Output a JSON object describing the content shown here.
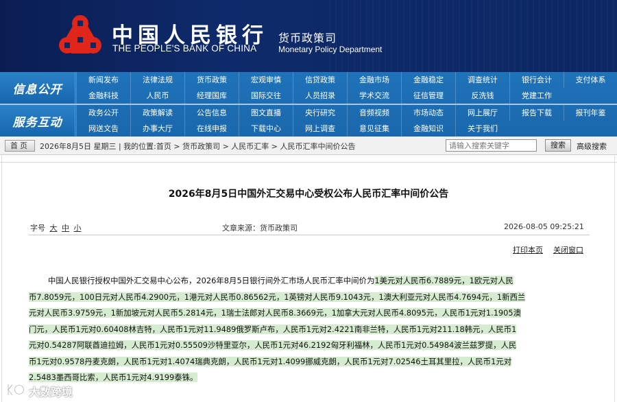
{
  "header": {
    "bank_name_cn": "中国人民银行",
    "bank_name_en": "THE PEOPLE'S BANK OF CHINA",
    "dept_cn": "货币政策司",
    "dept_en": "Monetary Policy Department",
    "emblem_color": "#e0251b",
    "bg_color": "#0c2763"
  },
  "nav": {
    "cat1": "信息公开",
    "cat2": "服务互动",
    "row1": [
      "新闻发布",
      "法律法规",
      "货币政策",
      "宏观审慎",
      "信贷政策",
      "金融市场",
      "金融稳定",
      "调查统计",
      "银行会计",
      "支付体系"
    ],
    "row2": [
      "金融科技",
      "人民币",
      "经理国库",
      "国际交往",
      "人员招录",
      "学术交流",
      "征信管理",
      "反洗钱",
      "党建工作",
      ""
    ],
    "row3": [
      "政务公开",
      "政策解读",
      "公告信息",
      "图文直播",
      "央行研究",
      "音频视频",
      "市场动态",
      "网上展厅",
      "报告下载",
      "报刊年鉴"
    ],
    "row4": [
      "网送文告",
      "办事大厅",
      "在线申报",
      "下载中心",
      "网上调查",
      "意见征集",
      "金融知识",
      "关于我们",
      "",
      ""
    ]
  },
  "breadcrumb": {
    "home": "首页",
    "text": "2026年8月5日 星期三 | 我的位置:首页 > 货币政策司 > 人民币汇率 > 人民币汇率中间价公告",
    "search_placeholder": "请输入搜索关键字",
    "search_button": "搜索",
    "advanced": "高级搜索"
  },
  "article": {
    "title": "2026年8月5日中国外汇交易中心受权公布人民币汇率中间价公告",
    "font_label": "字号",
    "font_large": "大",
    "font_medium": "中",
    "font_small": "小",
    "source": "文章来源：货币政策司",
    "date": "2026-08-05 09:25:21",
    "print": "打印本页",
    "close": "关闭窗口",
    "lines": [
      {
        "pre": "中国人民银行授权中国外汇交易中心公布，2026年8月5日银行间外汇市场人民币汇率中间价为",
        "hl": "1美元对人民币6.7889元，1欧元对人民"
      },
      {
        "pre": "",
        "hl": "币7.8059元，100日元对人民币4.2900元，1港元对人民币0.86562元，1英镑对人民币9.1043元，1澳大利亚元对人民币4.7694元，1新西兰"
      },
      {
        "pre": "",
        "hl": "元对人民币3.9759元，1新加坡元对人民币5.2814元，1瑞士法郎对人民币8.3669元，1加拿大元对人民币4.8095元，人民币1元对1.1905澳"
      },
      {
        "pre": "",
        "hl": "门元，人民币1元对0.60408林吉特，人民币1元对11.9489俄罗斯卢布，人民币1元对2.4221南非兰特，人民币1元对211.18韩元，人民币1"
      },
      {
        "pre": "",
        "hl": "元对0.54287阿联酋迪拉姆，人民币1元对0.55509沙特里亚尔，人民币1元对46.2192匈牙利福林，人民币1元对0.54984波兰兹罗提，人民"
      },
      {
        "pre": "",
        "hl": "币1元对0.9578丹麦克朗，人民币1元对1.4074瑞典克朗，人民币1元对1.4099挪威克朗，人民币1元对7.02546土耳其里拉，人民币1元对"
      },
      {
        "pre": "",
        "hl": "2.5483墨西哥比索，人民币1元对4.9199泰铢。"
      }
    ],
    "highlight_color": "#d6ecd0"
  },
  "watermark": {
    "text": "大数跨境"
  }
}
